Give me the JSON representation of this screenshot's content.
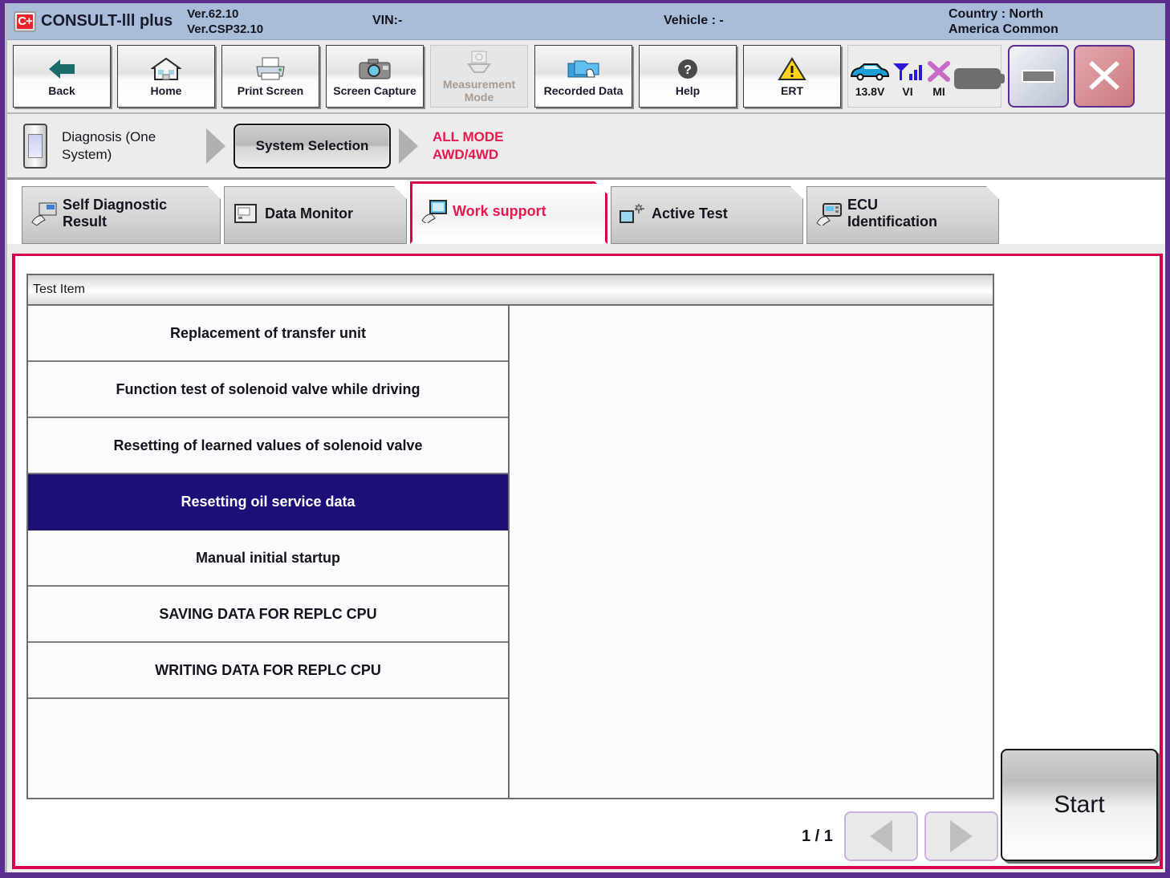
{
  "titlebar": {
    "logo_text": "C+",
    "logo_name": "consult-logo",
    "app_name": "CONSULT-lll plus",
    "version_line1": "Ver.62.10",
    "version_line2": "Ver.CSP32.10",
    "vin": "VIN:-",
    "vehicle": "Vehicle : -",
    "country_line1": "Country : North",
    "country_line2": "America Common"
  },
  "toolbar": {
    "buttons": [
      {
        "label": "Back",
        "icon": "back-arrow-icon",
        "disabled": false
      },
      {
        "label": "Home",
        "icon": "home-icon",
        "disabled": false
      },
      {
        "label": "Print Screen",
        "icon": "printer-icon",
        "disabled": false
      },
      {
        "label": "Screen\nCapture",
        "icon": "camera-icon",
        "disabled": false
      },
      {
        "label": "Measurement\nMode",
        "icon": "measurement-icon",
        "disabled": true
      },
      {
        "label": "Recorded\nData",
        "icon": "folders-icon",
        "disabled": false
      },
      {
        "label": "Help",
        "icon": "question-mark-icon",
        "disabled": false
      },
      {
        "label": "ERT",
        "icon": "warning-triangle-icon",
        "disabled": false
      }
    ],
    "status": [
      {
        "label": "13.8V",
        "icon": "car-icon"
      },
      {
        "label": "VI",
        "icon": "signal-icon"
      },
      {
        "label": "MI",
        "icon": "x-mark-icon"
      },
      {
        "label": "",
        "icon": "battery-icon"
      }
    ],
    "minimize_label": "minimize",
    "close_label": "close"
  },
  "breadcrumb": {
    "device_icon": "handheld-device-icon",
    "step1": "Diagnosis (One System)",
    "step2": "System Selection",
    "mode_line1": "ALL MODE",
    "mode_line2": "AWD/4WD"
  },
  "tabs": [
    {
      "label": "Self Diagnostic\nResult",
      "icon": "self-diagnostic-icon",
      "active": false
    },
    {
      "label": "Data Monitor",
      "icon": "data-monitor-icon",
      "active": false
    },
    {
      "label": "Work support",
      "icon": "work-support-icon",
      "active": true
    },
    {
      "label": "Active Test",
      "icon": "active-test-icon",
      "active": false
    },
    {
      "label": "ECU\nIdentification",
      "icon": "ecu-identification-icon",
      "active": false
    }
  ],
  "panel": {
    "column_header": "Test Item",
    "rows": [
      {
        "label": "Replacement of transfer unit",
        "selected": false
      },
      {
        "label": "Function test of solenoid valve while driving",
        "selected": false
      },
      {
        "label": "Resetting of learned values of solenoid valve",
        "selected": false
      },
      {
        "label": "Resetting oil service data",
        "selected": true
      },
      {
        "label": "Manual initial startup",
        "selected": false
      },
      {
        "label": "SAVING DATA FOR REPLC CPU",
        "selected": false
      },
      {
        "label": "WRITING DATA FOR REPLC CPU",
        "selected": false
      }
    ]
  },
  "pager": {
    "page_indicator": "1 / 1",
    "prev_label": "previous page",
    "next_label": "next page"
  },
  "actions": {
    "start_label": "Start"
  },
  "colors": {
    "accent_crimson": "#d6004f",
    "frame_purple": "#5b2d8e",
    "titlebar_blue": "#a9bdd9",
    "selection_navy": "#1c0f78",
    "mode_text": "#e8194f"
  }
}
